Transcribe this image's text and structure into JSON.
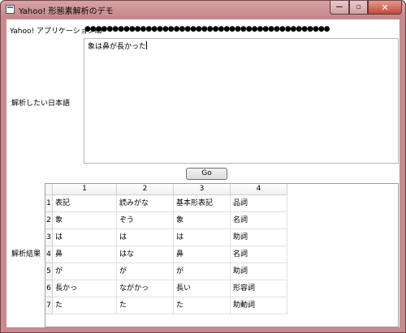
{
  "window": {
    "title": "Yahoo! 形態素解析のデモ",
    "minimize_glyph": "—",
    "maximize_glyph": "▫",
    "close_glyph": "✕"
  },
  "form": {
    "appid_label": "Yahoo! アプリケーションID",
    "appid_value": "●●●●●●●●●●●●●●●●●●●●●●●●●●●●●●●●●●●●●●●●●●●●",
    "text_label": "解析したい日本語",
    "text_value": "象は鼻が長かった",
    "go_label": "Go",
    "result_label": "解析結果"
  },
  "grid": {
    "columns": [
      "1",
      "2",
      "3",
      "4"
    ],
    "rows": [
      {
        "num": "1",
        "cells": [
          "表記",
          "読みがな",
          "基本形表記",
          "品詞"
        ]
      },
      {
        "num": "2",
        "cells": [
          "象",
          "ぞう",
          "象",
          "名詞"
        ]
      },
      {
        "num": "3",
        "cells": [
          "は",
          "は",
          "は",
          "助詞"
        ]
      },
      {
        "num": "4",
        "cells": [
          "鼻",
          "はな",
          "鼻",
          "名詞"
        ]
      },
      {
        "num": "5",
        "cells": [
          "が",
          "が",
          "が",
          "助詞"
        ]
      },
      {
        "num": "6",
        "cells": [
          "長かっ",
          "ながかっ",
          "長い",
          "形容詞"
        ]
      },
      {
        "num": "7",
        "cells": [
          "た",
          "た",
          "た",
          "助動詞"
        ]
      }
    ]
  }
}
